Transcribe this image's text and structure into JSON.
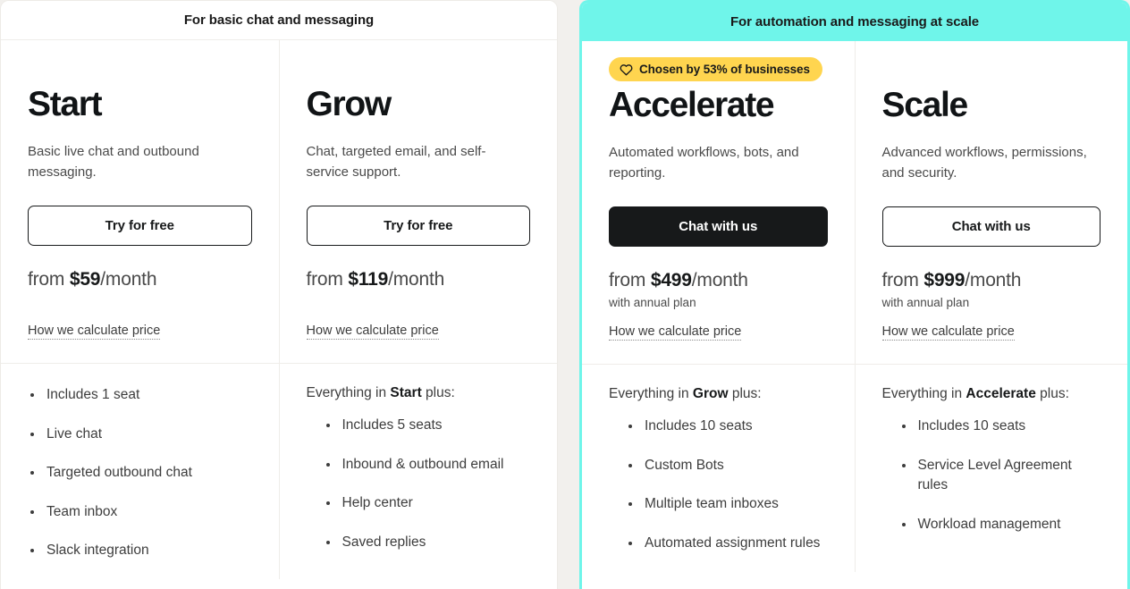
{
  "colors": {
    "highlight_teal": "#6FF5EA",
    "badge_yellow": "#FFD54F",
    "dark_button": "#17191a",
    "page_background": "#F2F0ED",
    "card_background": "#ffffff",
    "divider": "#EFEDE9"
  },
  "groups": [
    {
      "header": "For basic chat and messaging",
      "highlighted": false,
      "plans": [
        {
          "name": "Start",
          "description": "Basic live chat and outbound messaging.",
          "cta_label": "Try for free",
          "cta_style": "outline",
          "price_prefix": "from",
          "price_amount": "$59",
          "price_period": "/month",
          "price_note": "",
          "calculate_link": "How we calculate price",
          "features_intro_prefix": "",
          "features_intro_bold": "",
          "features_intro_suffix": "",
          "features": [
            "Includes 1 seat",
            "Live chat",
            "Targeted outbound chat",
            "Team inbox",
            "Slack integration"
          ]
        },
        {
          "name": "Grow",
          "description": "Chat, targeted email, and self-service support.",
          "cta_label": "Try for free",
          "cta_style": "outline",
          "price_prefix": "from",
          "price_amount": "$119",
          "price_period": "/month",
          "price_note": "",
          "calculate_link": "How we calculate price",
          "features_intro_prefix": "Everything in ",
          "features_intro_bold": "Start",
          "features_intro_suffix": " plus:",
          "features": [
            "Includes 5 seats",
            "Inbound & outbound email",
            "Help center",
            "Saved replies"
          ]
        }
      ]
    },
    {
      "header": "For automation and messaging at scale",
      "highlighted": true,
      "badge": {
        "icon": "heart-icon",
        "label": "Chosen by 53% of businesses"
      },
      "plans": [
        {
          "name": "Accelerate",
          "description": "Automated workflows, bots, and reporting.",
          "cta_label": "Chat with us",
          "cta_style": "solid",
          "price_prefix": "from",
          "price_amount": "$499",
          "price_period": "/month",
          "price_note": "with annual plan",
          "calculate_link": "How we calculate price",
          "features_intro_prefix": "Everything in ",
          "features_intro_bold": "Grow",
          "features_intro_suffix": " plus:",
          "features": [
            "Includes 10 seats",
            "Custom Bots",
            "Multiple team inboxes",
            "Automated assignment rules"
          ]
        },
        {
          "name": "Scale",
          "description": "Advanced workflows, permissions, and security.",
          "cta_label": "Chat with us",
          "cta_style": "outline",
          "price_prefix": "from",
          "price_amount": "$999",
          "price_period": "/month",
          "price_note": "with annual plan",
          "calculate_link": "How we calculate price",
          "features_intro_prefix": "Everything in ",
          "features_intro_bold": "Accelerate",
          "features_intro_suffix": " plus:",
          "features": [
            "Includes 10 seats",
            "Service Level Agreement rules",
            "Workload management"
          ]
        }
      ]
    }
  ]
}
